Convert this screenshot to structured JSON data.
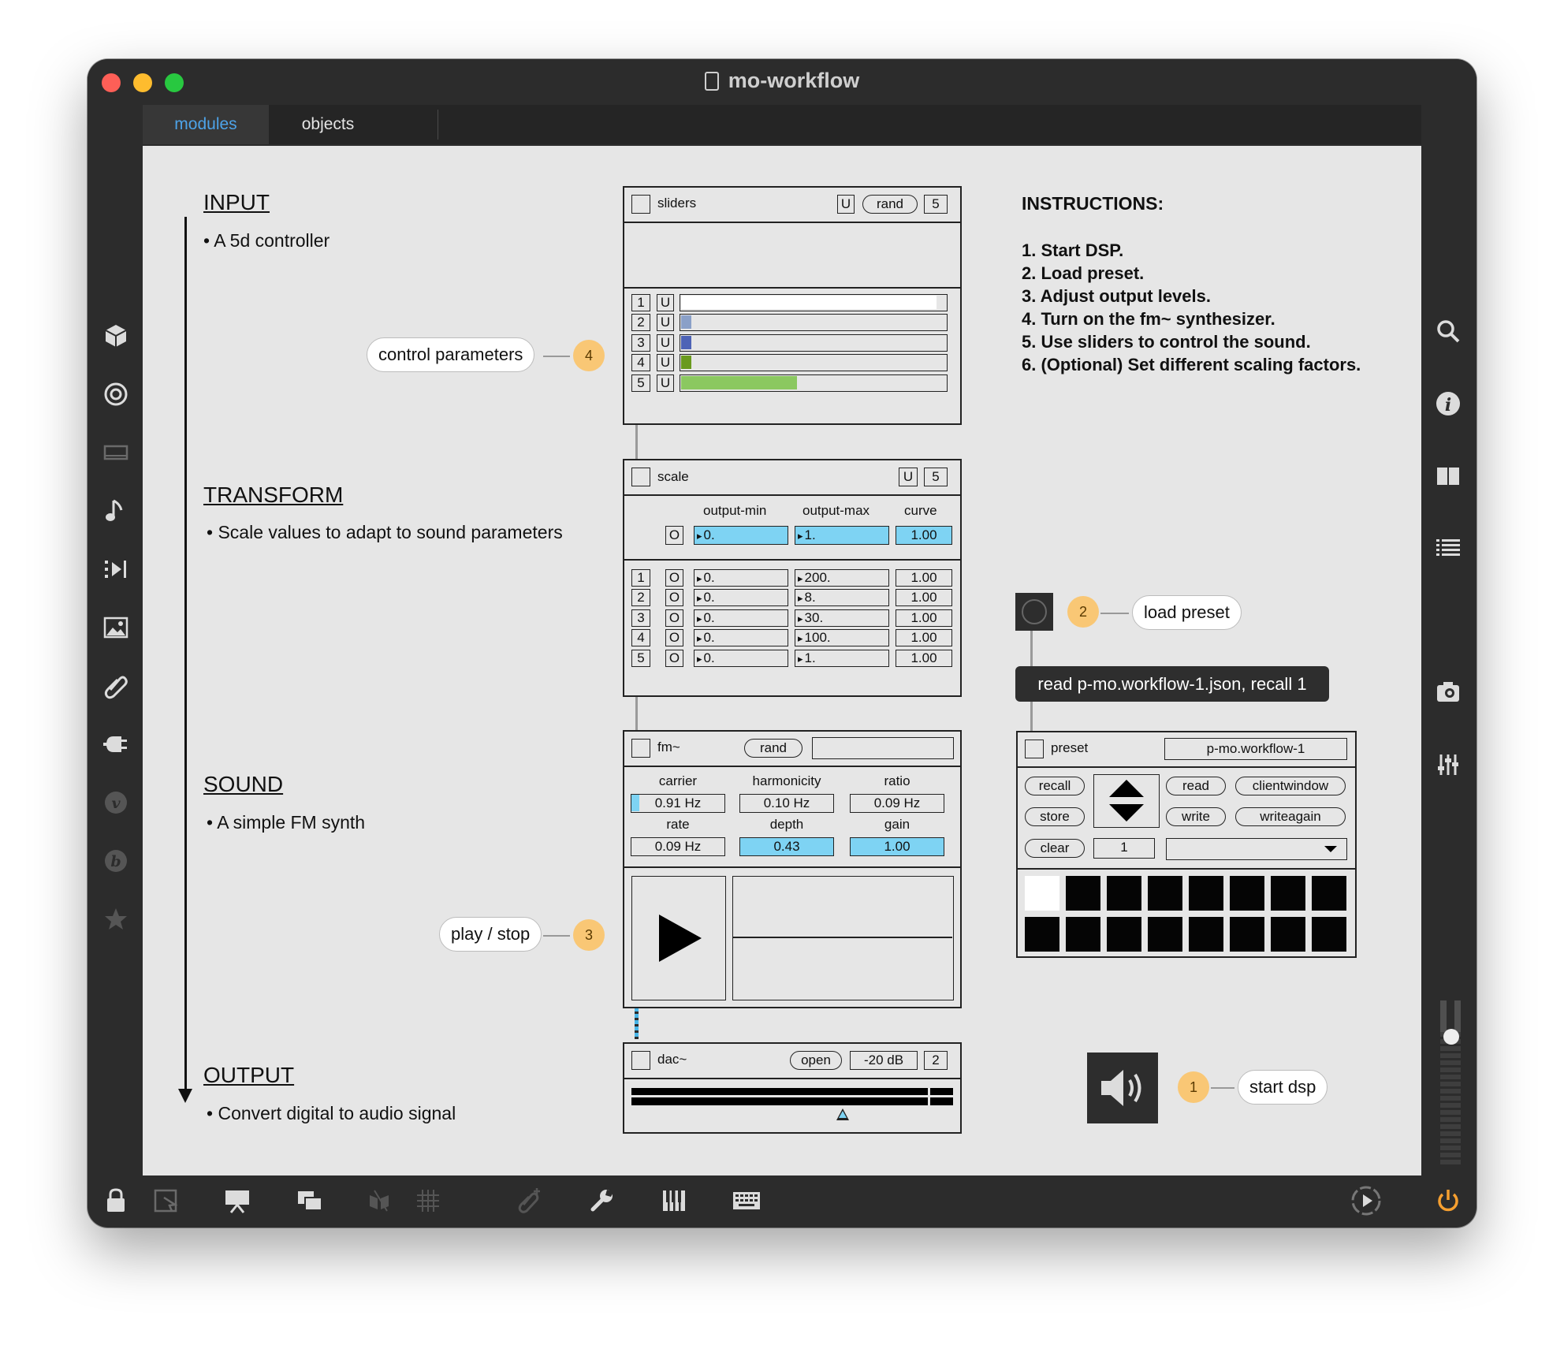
{
  "window": {
    "title": "mo-workflow"
  },
  "tabs": [
    {
      "label": "modules"
    },
    {
      "label": "objects"
    }
  ],
  "sections": {
    "input": {
      "heading": "INPUT",
      "desc": "A 5d controller"
    },
    "transform": {
      "heading": "TRANSFORM",
      "desc": "Scale values to adapt to sound parameters"
    },
    "sound": {
      "heading": "SOUND",
      "desc": "A simple FM synth"
    },
    "output": {
      "heading": "OUTPUT",
      "desc": "Convert digital to audio signal"
    }
  },
  "instructions": {
    "title": "INSTRUCTIONS:",
    "steps": [
      "1. Start DSP.",
      "2. Load preset.",
      "3. Adjust output levels.",
      "4. Turn on the fm~ synthesizer.",
      "5. Use sliders to control the sound.",
      "6. (Optional) Set different scaling factors."
    ]
  },
  "sliders_module": {
    "title": "sliders",
    "u": "U",
    "rand": "rand",
    "count": "5",
    "rows": [
      {
        "index": "1",
        "u": "U",
        "level": 0.97,
        "color": "#ffffff"
      },
      {
        "index": "2",
        "u": "U",
        "level": 0.04,
        "color": "#8aa0c8"
      },
      {
        "index": "3",
        "u": "U",
        "level": 0.04,
        "color": "#4e63b6"
      },
      {
        "index": "4",
        "u": "U",
        "level": 0.04,
        "color": "#6a9a1e"
      },
      {
        "index": "5",
        "u": "U",
        "level": 0.44,
        "color": "#8bc860"
      }
    ]
  },
  "scale_module": {
    "title": "scale",
    "u": "U",
    "count": "5",
    "col_min": "output-min",
    "col_max": "output-max",
    "col_curve": "curve",
    "master": {
      "o": "O",
      "min": "0.",
      "max": "1.",
      "curve": "1.00"
    },
    "rows": [
      {
        "index": "1",
        "o": "O",
        "min": "0.",
        "max": "200.",
        "curve": "1.00"
      },
      {
        "index": "2",
        "o": "O",
        "min": "0.",
        "max": "8.",
        "curve": "1.00"
      },
      {
        "index": "3",
        "o": "O",
        "min": "0.",
        "max": "30.",
        "curve": "1.00"
      },
      {
        "index": "4",
        "o": "O",
        "min": "0.",
        "max": "100.",
        "curve": "1.00"
      },
      {
        "index": "5",
        "o": "O",
        "min": "0.",
        "max": "1.",
        "curve": "1.00"
      }
    ]
  },
  "fm_module": {
    "title": "fm~",
    "rand": "rand",
    "carrier_label": "carrier",
    "carrier": "0.91 Hz",
    "harmonicity_label": "harmonicity",
    "harmonicity": "0.10 Hz",
    "ratio_label": "ratio",
    "ratio": "0.09 Hz",
    "rate_label": "rate",
    "rate": "0.09 Hz",
    "depth_label": "depth",
    "depth": "0.43",
    "gain_label": "gain",
    "gain": "1.00"
  },
  "dac_module": {
    "title": "dac~",
    "open": "open",
    "db": "-20 dB",
    "channels": "2"
  },
  "preset_module": {
    "title": "preset",
    "name": "p-mo.workflow-1",
    "recall": "recall",
    "store": "store",
    "clear": "clear",
    "read": "read",
    "write": "write",
    "clientwindow": "clientwindow",
    "writeagain": "writeagain",
    "slot_number": "1"
  },
  "message": "read p-mo.workflow-1.json, recall 1",
  "callouts": {
    "control": {
      "label": "control parameters",
      "badge": "4"
    },
    "play": {
      "label": "play / stop",
      "badge": "3"
    },
    "load": {
      "label": "load preset",
      "badge": "2"
    },
    "dsp": {
      "label": "start dsp",
      "badge": "1"
    }
  },
  "colors": {
    "accent_blue": "#7ed3f3",
    "badge": "#f9c775",
    "tab_active": "#4da3e8"
  }
}
